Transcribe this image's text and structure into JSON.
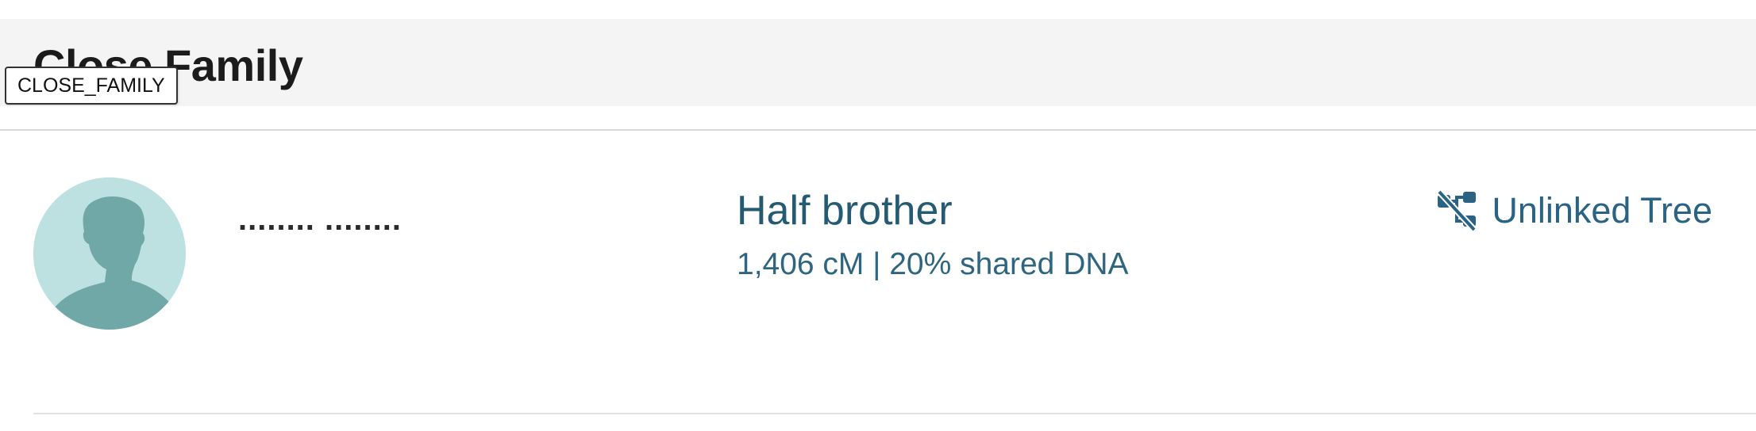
{
  "section": {
    "title": "Close Family",
    "debug_tag": "CLOSE_FAMILY"
  },
  "match": {
    "avatar_icon": "person-silhouette-icon",
    "name_masked": "........  ........",
    "relationship": "Half brother",
    "dna_summary": "1,406 cM | 20% shared DNA",
    "tree_status_label": "Unlinked Tree",
    "tree_status_icon": "unlinked-tree-icon"
  },
  "colors": {
    "header_bg": "#f4f4f4",
    "link_blue": "#2b6384",
    "avatar_bg": "#bde0e0",
    "avatar_figure": "#6fa8a7"
  }
}
